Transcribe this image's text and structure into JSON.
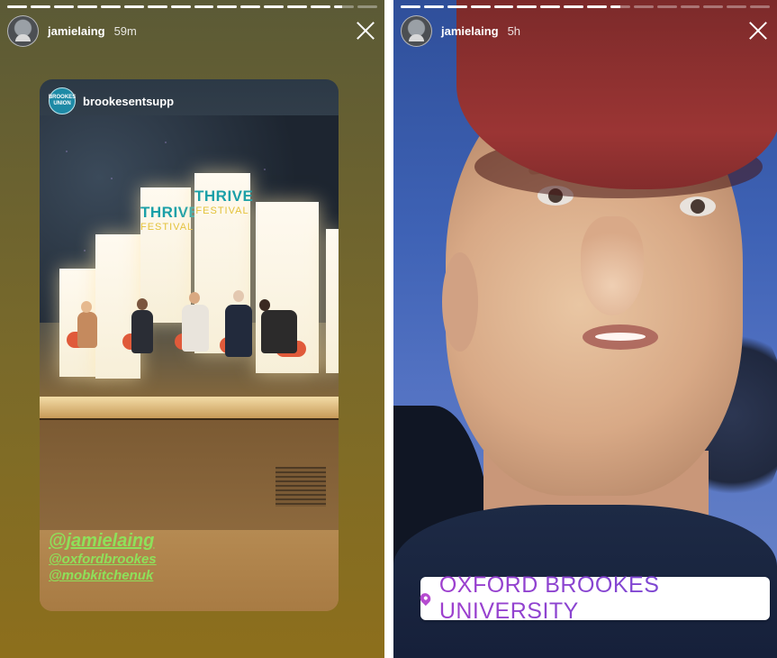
{
  "stories": [
    {
      "username": "jamielaing",
      "time": "59m",
      "progress": [
        1,
        1,
        1,
        1,
        1,
        1,
        1,
        1,
        1,
        1,
        1,
        1,
        1,
        1,
        0.4,
        0
      ],
      "reshare": {
        "username": "brookesentsupp",
        "avatar_text": "BROOKES UNION",
        "banner_title": "THRIVE",
        "banner_sub": "FESTIVAL",
        "mentions": [
          "@jamielaing",
          "@oxfordbrookes",
          "@mobkitchenuk"
        ]
      }
    },
    {
      "username": "jamielaing",
      "time": "5h",
      "progress": [
        1,
        1,
        1,
        1,
        1,
        1,
        1,
        1,
        1,
        0.5,
        0,
        0,
        0,
        0,
        0,
        0
      ],
      "location_sticker": "OXFORD BROOKES UNIVERSITY"
    }
  ],
  "colors": {
    "mention_green": "#8ee05a",
    "sticker_purple": "#8d3fcf",
    "banner_teal": "#1aa0a8"
  },
  "icons": [
    "close-icon",
    "location-pin-icon"
  ]
}
